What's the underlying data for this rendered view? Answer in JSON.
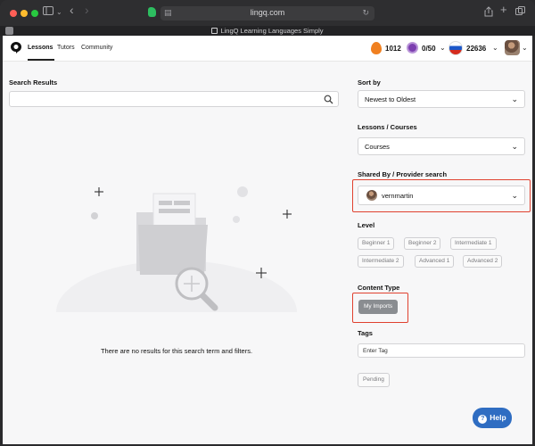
{
  "browser": {
    "url": "lingq.com",
    "tab_title": "LingQ Learning Languages Simply",
    "nav_back": "‹",
    "nav_forward": "›"
  },
  "navbar": {
    "links": [
      "Lessons",
      "Tutors",
      "Community"
    ],
    "streak": "1012",
    "daily_goal": "0/50",
    "known_words": "22636",
    "chevron": "⌄"
  },
  "search": {
    "label": "Search Results",
    "placeholder": ""
  },
  "empty_state": {
    "message": "There are no results for this search term and filters."
  },
  "filters": {
    "sort_by": {
      "label": "Sort by",
      "value": "Newest to Oldest"
    },
    "lessons_courses": {
      "label": "Lessons / Courses",
      "value": "Courses"
    },
    "shared_by": {
      "label": "Shared By / Provider search",
      "value": "vernmartin"
    },
    "level": {
      "label": "Level",
      "options": [
        "Beginner 1",
        "Beginner 2",
        "Intermediate 1",
        "Intermediate 2",
        "Advanced 1",
        "Advanced 2"
      ]
    },
    "content_type": {
      "label": "Content Type",
      "active": "My Imports"
    },
    "tags": {
      "label": "Tags",
      "placeholder": "Enter Tag"
    },
    "status": {
      "pending": "Pending"
    }
  },
  "help": {
    "label": "Help",
    "icon": "?"
  },
  "colors": {
    "highlight": "#e0412f",
    "help_button": "#2f6dc2",
    "chip_active": "#8a8d91"
  },
  "icons": {
    "select_chevron": "⌄"
  }
}
